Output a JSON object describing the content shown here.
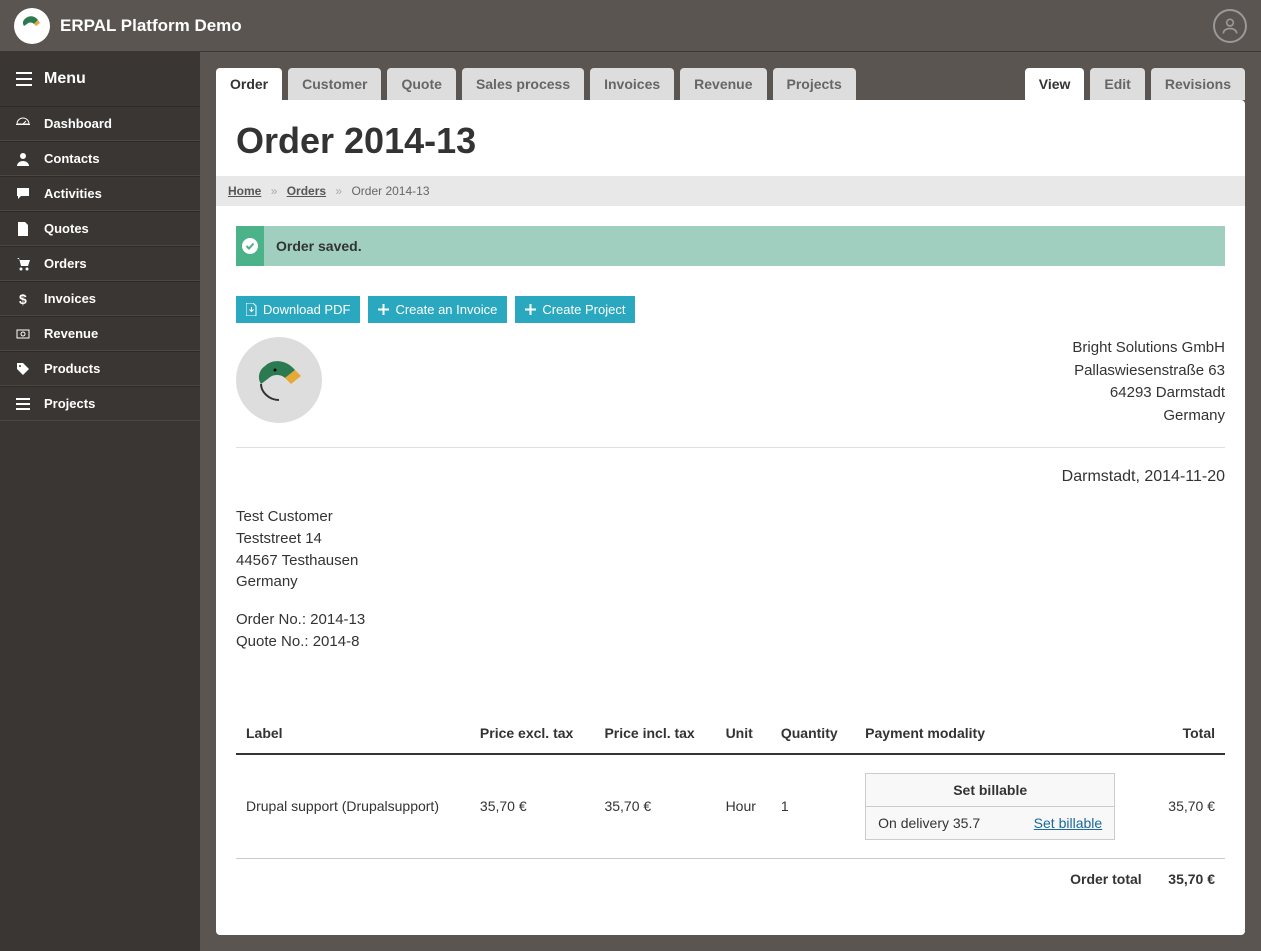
{
  "site": {
    "title": "ERPAL Platform Demo"
  },
  "sidebar": {
    "menu_label": "Menu",
    "items": [
      {
        "label": "Dashboard",
        "icon": "dashboard"
      },
      {
        "label": "Contacts",
        "icon": "user"
      },
      {
        "label": "Activities",
        "icon": "comment"
      },
      {
        "label": "Quotes",
        "icon": "file"
      },
      {
        "label": "Orders",
        "icon": "cart"
      },
      {
        "label": "Invoices",
        "icon": "dollar"
      },
      {
        "label": "Revenue",
        "icon": "money"
      },
      {
        "label": "Products",
        "icon": "tag"
      },
      {
        "label": "Projects",
        "icon": "list"
      }
    ]
  },
  "tabs_left": [
    {
      "label": "Order",
      "active": true
    },
    {
      "label": "Customer",
      "active": false
    },
    {
      "label": "Quote",
      "active": false
    },
    {
      "label": "Sales process",
      "active": false
    },
    {
      "label": "Invoices",
      "active": false
    },
    {
      "label": "Revenue",
      "active": false
    },
    {
      "label": "Projects",
      "active": false
    }
  ],
  "tabs_right": [
    {
      "label": "View",
      "active": true
    },
    {
      "label": "Edit",
      "active": false
    },
    {
      "label": "Revisions",
      "active": false
    }
  ],
  "page": {
    "title": "Order 2014-13"
  },
  "breadcrumb": {
    "home": "Home",
    "orders": "Orders",
    "current": "Order 2014-13"
  },
  "message": {
    "text": "Order saved."
  },
  "actions": {
    "download_pdf": "Download PDF",
    "create_invoice": "Create an Invoice",
    "create_project": "Create Project"
  },
  "vendor": {
    "name": "Bright Solutions GmbH",
    "street": "Pallaswiesenstraße 63",
    "city": "64293 Darmstadt",
    "country": "Germany"
  },
  "date_line": "Darmstadt, 2014-11-20",
  "customer": {
    "name": "Test Customer",
    "street": "Teststreet 14",
    "city": "44567 Testhausen",
    "country": "Germany"
  },
  "order_meta": {
    "order_no": "Order No.: 2014-13",
    "quote_no": "Quote No.: 2014-8"
  },
  "table": {
    "headers": {
      "label": "Label",
      "price_excl": "Price excl. tax",
      "price_incl": "Price incl. tax",
      "unit": "Unit",
      "qty": "Quantity",
      "payment": "Payment modality",
      "total": "Total"
    },
    "rows": [
      {
        "label": "Drupal support (Drupalsupport)",
        "price_excl": "35,70 €",
        "price_incl": "35,70 €",
        "unit": "Hour",
        "qty": "1",
        "pm_head": "Set billable",
        "pm_left": "On delivery 35.7",
        "pm_link": "Set billable",
        "total": "35,70 €"
      }
    ],
    "footer": {
      "label": "Order total",
      "total": "35,70 €"
    }
  }
}
